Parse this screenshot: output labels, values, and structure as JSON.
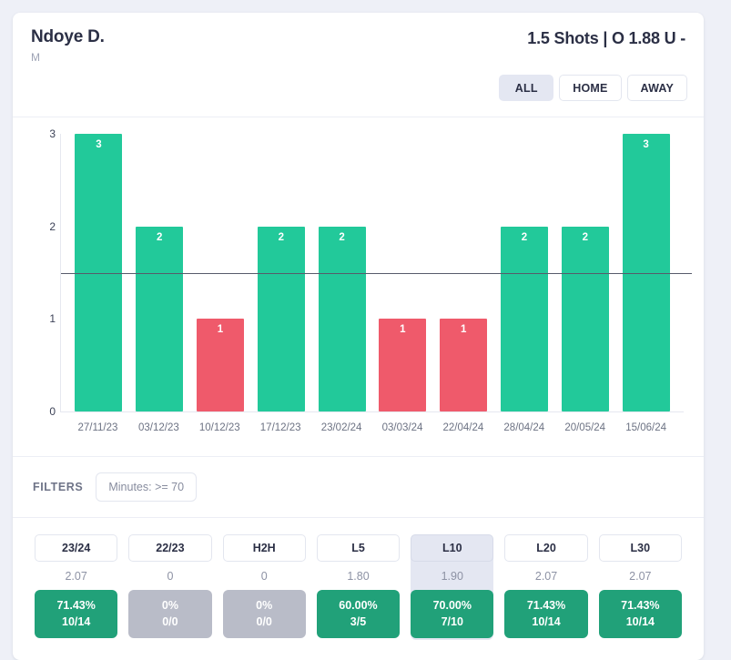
{
  "header": {
    "player_name": "Ndoye D.",
    "player_position": "M",
    "market": "1.5 Shots | O 1.88 U -",
    "tabs": [
      {
        "label": "ALL",
        "selected": true
      },
      {
        "label": "HOME",
        "selected": false
      },
      {
        "label": "AWAY",
        "selected": false
      }
    ]
  },
  "chart_data": {
    "type": "bar",
    "title": "",
    "xlabel": "",
    "ylabel": "",
    "ylim": [
      0,
      3
    ],
    "yticks": [
      "0",
      "1",
      "2",
      "3"
    ],
    "grid": false,
    "threshold": 1.5,
    "threshold_label": "1.5",
    "colors": {
      "over": "#22c99a",
      "under": "#ef5a6b"
    },
    "categories": [
      "27/11/23",
      "03/12/23",
      "10/12/23",
      "17/12/23",
      "23/02/24",
      "03/03/24",
      "22/04/24",
      "28/04/24",
      "20/05/24",
      "15/06/24"
    ],
    "values": [
      3,
      2,
      1,
      2,
      2,
      1,
      1,
      2,
      2,
      3
    ],
    "bars": [
      {
        "date": "27/11/23",
        "value": 3,
        "label": "3",
        "result": "over"
      },
      {
        "date": "03/12/23",
        "value": 2,
        "label": "2",
        "result": "over"
      },
      {
        "date": "10/12/23",
        "value": 1,
        "label": "1",
        "result": "under"
      },
      {
        "date": "17/12/23",
        "value": 2,
        "label": "2",
        "result": "over"
      },
      {
        "date": "23/02/24",
        "value": 2,
        "label": "2",
        "result": "over"
      },
      {
        "date": "03/03/24",
        "value": 1,
        "label": "1",
        "result": "under"
      },
      {
        "date": "22/04/24",
        "value": 1,
        "label": "1",
        "result": "under"
      },
      {
        "date": "28/04/24",
        "value": 2,
        "label": "2",
        "result": "over"
      },
      {
        "date": "20/05/24",
        "value": 2,
        "label": "2",
        "result": "over"
      },
      {
        "date": "15/06/24",
        "value": 3,
        "label": "3",
        "result": "over"
      }
    ]
  },
  "filters": {
    "label": "FILTERS",
    "chips": [
      {
        "label": "Minutes: >= 70"
      }
    ]
  },
  "stats": {
    "columns": [
      {
        "header": "23/24",
        "average": "2.07",
        "percent": "71.43%",
        "ratio": "10/14",
        "state": "positive",
        "selected": false
      },
      {
        "header": "22/23",
        "average": "0",
        "percent": "0%",
        "ratio": "0/0",
        "state": "empty",
        "selected": false
      },
      {
        "header": "H2H",
        "average": "0",
        "percent": "0%",
        "ratio": "0/0",
        "state": "empty",
        "selected": false
      },
      {
        "header": "L5",
        "average": "1.80",
        "percent": "60.00%",
        "ratio": "3/5",
        "state": "positive",
        "selected": false
      },
      {
        "header": "L10",
        "average": "1.90",
        "percent": "70.00%",
        "ratio": "7/10",
        "state": "positive",
        "selected": true
      },
      {
        "header": "L20",
        "average": "2.07",
        "percent": "71.43%",
        "ratio": "10/14",
        "state": "positive",
        "selected": false
      },
      {
        "header": "L30",
        "average": "2.07",
        "percent": "71.43%",
        "ratio": "10/14",
        "state": "positive",
        "selected": false
      }
    ],
    "colors": {
      "positive": "#21a179",
      "empty": "#b9bcc8"
    }
  }
}
